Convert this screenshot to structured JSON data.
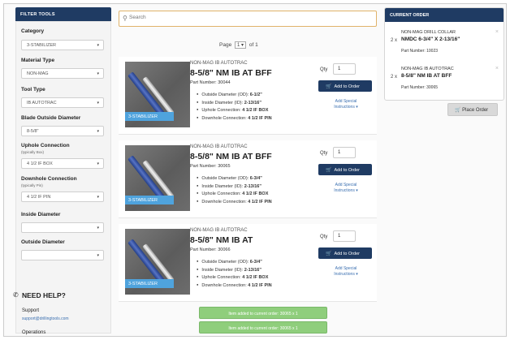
{
  "filter": {
    "title": "FILTER TOOLS",
    "fields": [
      {
        "label": "Category",
        "value": "3-STABILIZER"
      },
      {
        "label": "Material Type",
        "value": "NON-MAG"
      },
      {
        "label": "Tool Type",
        "value": "IB AUTOTRAC"
      },
      {
        "label": "Blade Outside Diameter",
        "value": "8-5/8\""
      },
      {
        "label": "Uphole Connection",
        "sub": "(typically Box)",
        "value": "4 1/2 IF BOX"
      },
      {
        "label": "Downhole Connection",
        "sub": "(typically Pin)",
        "value": "4 1/2 IF PIN"
      },
      {
        "label": "Inside Diameter",
        "value": ""
      },
      {
        "label": "Outside Diameter",
        "value": ""
      }
    ]
  },
  "help": {
    "title": "NEED HELP?",
    "support_label": "Support",
    "support_email": "support@drillingtools.com",
    "operations_label": "Operations"
  },
  "search": {
    "placeholder": "Search"
  },
  "pager": {
    "label": "Page",
    "current": "1",
    "of_label": "of 1"
  },
  "products": [
    {
      "tag": "3-STABILIZER",
      "type": "NON-MAG IB AUTOTRAC",
      "title": "8-5/8\" NM IB AT BFF",
      "part": "Part Number: 30044",
      "specs": [
        {
          "label": "Outside Diameter (OD):",
          "value": "6-1/2\""
        },
        {
          "label": "Inside Diameter (ID):",
          "value": "2-13/16\""
        },
        {
          "label": "Uphole Connection:",
          "value": "4 1/2 IF BOX"
        },
        {
          "label": "Downhole Connection:",
          "value": "4 1/2 IF PIN"
        }
      ],
      "qty_label": "Qty",
      "qty": "1",
      "add_label": "Add to Order",
      "special_label": "Add Special Instructions ▾"
    },
    {
      "tag": "3-STABILIZER",
      "type": "NON-MAG IB AUTOTRAC",
      "title": "8-5/8\" NM IB AT BFF",
      "part": "Part Number: 30065",
      "specs": [
        {
          "label": "Outside Diameter (OD):",
          "value": "6-3/4\""
        },
        {
          "label": "Inside Diameter (ID):",
          "value": "2-13/16\""
        },
        {
          "label": "Uphole Connection:",
          "value": "4 1/2 IF BOX"
        },
        {
          "label": "Downhole Connection:",
          "value": "4 1/2 IF PIN"
        }
      ],
      "qty_label": "Qty",
      "qty": "1",
      "add_label": "Add to Order",
      "special_label": "Add Special Instructions ▾"
    },
    {
      "tag": "3-STABILIZER",
      "type": "NON-MAG IB AUTOTRAC",
      "title": "8-5/8\" NM IB AT",
      "part": "Part Number: 30066",
      "specs": [
        {
          "label": "Outside Diameter (OD):",
          "value": "6-3/4\""
        },
        {
          "label": "Inside Diameter (ID):",
          "value": "2-13/16\""
        },
        {
          "label": "Uphole Connection:",
          "value": "4 1/2 IF BOX"
        },
        {
          "label": "Downhole Connection:",
          "value": "4 1/2 IF PIN"
        }
      ],
      "qty_label": "Qty",
      "qty": "1",
      "add_label": "Add to Order",
      "special_label": "Add Special Instructions ▾"
    }
  ],
  "order": {
    "title": "CURRENT ORDER",
    "items": [
      {
        "qty": "2 x",
        "line1": "NON-MAG DRILL COLLAR",
        "line2": "NMDC 6-3/4\" X 2-13/16\"",
        "part": "Part Number: 10023"
      },
      {
        "qty": "2 x",
        "line1": "NON-MAG IB AUTOTRAC",
        "line2": "8-5/8\" NM IB AT BFF",
        "part": "Part Number: 30065"
      }
    ],
    "place_label": "Place Order"
  },
  "toasts": [
    "Item added to current order: 30065 x 1",
    "Item added to current order: 30065 x 1"
  ],
  "colors": {
    "navy": "#1f3b63",
    "tag_blue": "#4fa3dd",
    "toast_green": "#8fce7c",
    "search_border": "#e0b36a"
  }
}
